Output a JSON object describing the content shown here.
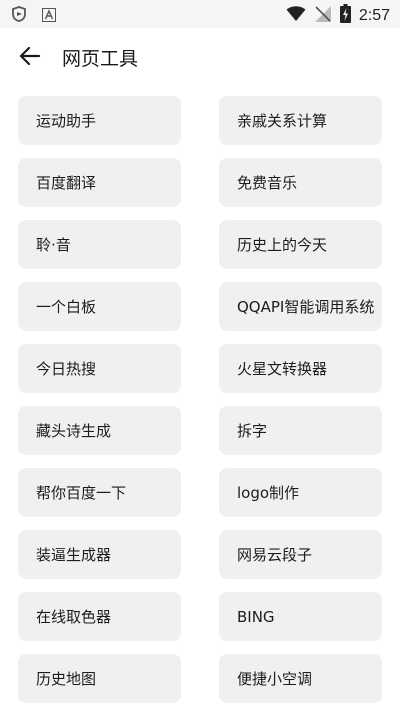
{
  "status_bar": {
    "time": "2:57",
    "icons": [
      "shield-app-icon",
      "a-app-icon",
      "wifi-icon",
      "signal-off-icon",
      "battery-charging-icon"
    ]
  },
  "header": {
    "title": "网页工具",
    "back_icon": "arrow-left-icon"
  },
  "tools": [
    {
      "label": "运动助手"
    },
    {
      "label": "亲戚关系计算"
    },
    {
      "label": "百度翻译"
    },
    {
      "label": "免费音乐"
    },
    {
      "label": "聆·音"
    },
    {
      "label": "历史上的今天"
    },
    {
      "label": "一个白板"
    },
    {
      "label": "QQAPI智能调用系统"
    },
    {
      "label": "今日热搜"
    },
    {
      "label": "火星文转换器"
    },
    {
      "label": "藏头诗生成"
    },
    {
      "label": "拆字"
    },
    {
      "label": "帮你百度一下"
    },
    {
      "label": "logo制作"
    },
    {
      "label": "装逼生成器"
    },
    {
      "label": "网易云段子"
    },
    {
      "label": "在线取色器"
    },
    {
      "label": "BING"
    },
    {
      "label": "历史地图"
    },
    {
      "label": "便捷小空调"
    }
  ]
}
